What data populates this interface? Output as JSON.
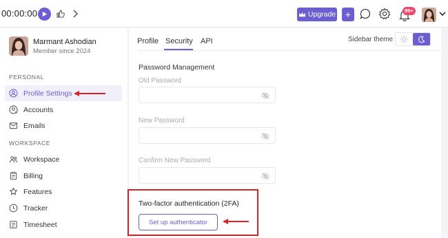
{
  "topbar": {
    "timer": "00:00:00",
    "upgrade_label": "Upgrade",
    "plus_label": "+",
    "notification_count": "99+"
  },
  "user": {
    "name": "Marmant Ashodian",
    "member_since": "Member since 2024"
  },
  "sidebar": {
    "personal_label": "PERSONAL",
    "workspace_label": "WORKSPACE",
    "personal_items": [
      {
        "label": "Profile Settings",
        "icon": "user-circle-icon",
        "active": true
      },
      {
        "label": "Accounts",
        "icon": "accounts-icon"
      },
      {
        "label": "Emails",
        "icon": "mail-icon"
      }
    ],
    "workspace_items": [
      {
        "label": "Workspace",
        "icon": "team-icon"
      },
      {
        "label": "Billing",
        "icon": "clipboard-icon"
      },
      {
        "label": "Features",
        "icon": "star-icon"
      },
      {
        "label": "Tracker",
        "icon": "clock-icon"
      },
      {
        "label": "Timesheet",
        "icon": "sheet-icon"
      }
    ]
  },
  "tabs": [
    {
      "label": "Profile"
    },
    {
      "label": "Security",
      "active": true
    },
    {
      "label": "API"
    }
  ],
  "theme": {
    "label": "Sidebar theme",
    "selected": "dark"
  },
  "password": {
    "title": "Password Management",
    "old_label": "Old Password",
    "new_label": "New Password",
    "confirm_label": "Confirm New Password"
  },
  "twofa": {
    "title": "Two-factor authentication (2FA)",
    "button_label": "Set up authenticator"
  },
  "colors": {
    "accent": "#6c5dd3",
    "annotation_red": "#e02020",
    "badge": "#f04770"
  }
}
